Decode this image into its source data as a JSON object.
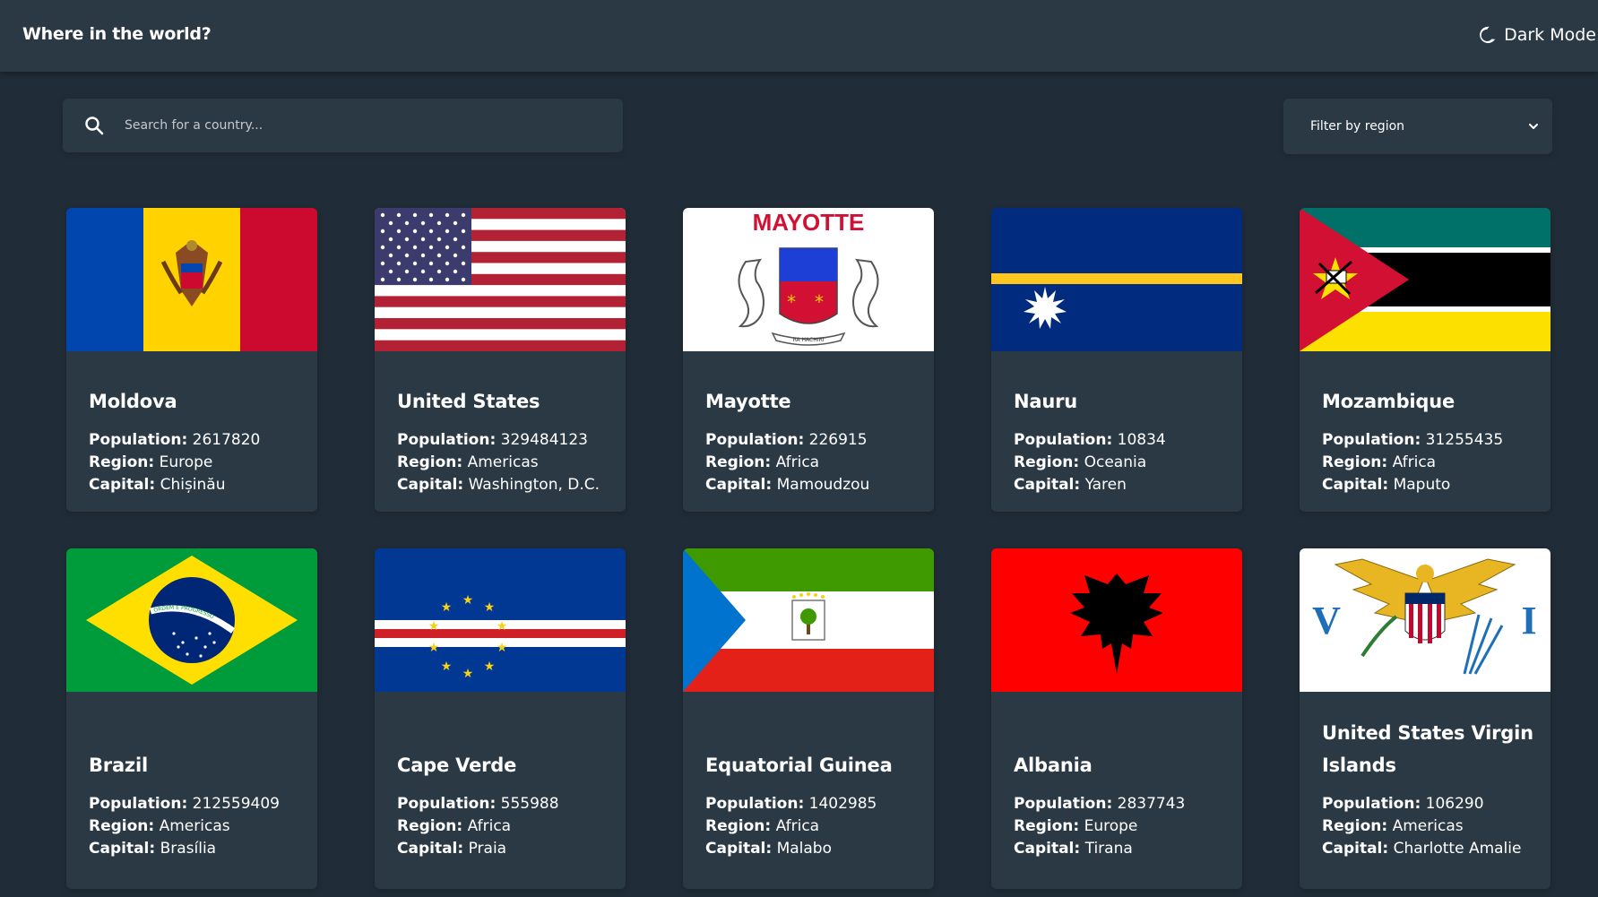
{
  "header": {
    "title": "Where in the world?",
    "theme_toggle_label": "Dark Mode"
  },
  "search": {
    "placeholder": "Search for a country...",
    "value": ""
  },
  "filter": {
    "label": "Filter by region"
  },
  "labels": {
    "population": "Population:",
    "region": "Region:",
    "capital": "Capital:"
  },
  "countries": [
    {
      "name": "Moldova",
      "population": "2617820",
      "region": "Europe",
      "capital": "Chișinău"
    },
    {
      "name": "United States",
      "population": "329484123",
      "region": "Americas",
      "capital": "Washington, D.C."
    },
    {
      "name": "Mayotte",
      "population": "226915",
      "region": "Africa",
      "capital": "Mamoudzou",
      "flag_text": "MAYOTTE",
      "flag_motto": "RA HACHIRI"
    },
    {
      "name": "Nauru",
      "population": "10834",
      "region": "Oceania",
      "capital": "Yaren"
    },
    {
      "name": "Mozambique",
      "population": "31255435",
      "region": "Africa",
      "capital": "Maputo"
    },
    {
      "name": "Brazil",
      "population": "212559409",
      "region": "Americas",
      "capital": "Brasília",
      "flag_text": "ORDEM E PROGRESSO"
    },
    {
      "name": "Cape Verde",
      "population": "555988",
      "region": "Africa",
      "capital": "Praia"
    },
    {
      "name": "Equatorial Guinea",
      "population": "1402985",
      "region": "Africa",
      "capital": "Malabo"
    },
    {
      "name": "Albania",
      "population": "2837743",
      "region": "Europe",
      "capital": "Tirana"
    },
    {
      "name": "United States Virgin Islands",
      "population": "106290",
      "region": "Americas",
      "capital": "Charlotte Amalie",
      "flag_text_left": "V",
      "flag_text_right": "I"
    }
  ],
  "colors": {
    "background": "#202c37",
    "elements": "#2b3945",
    "text": "#ffffff"
  },
  "icons": {
    "theme_toggle": "moon-icon",
    "search": "search-icon",
    "filter": "chevron-down-icon"
  }
}
